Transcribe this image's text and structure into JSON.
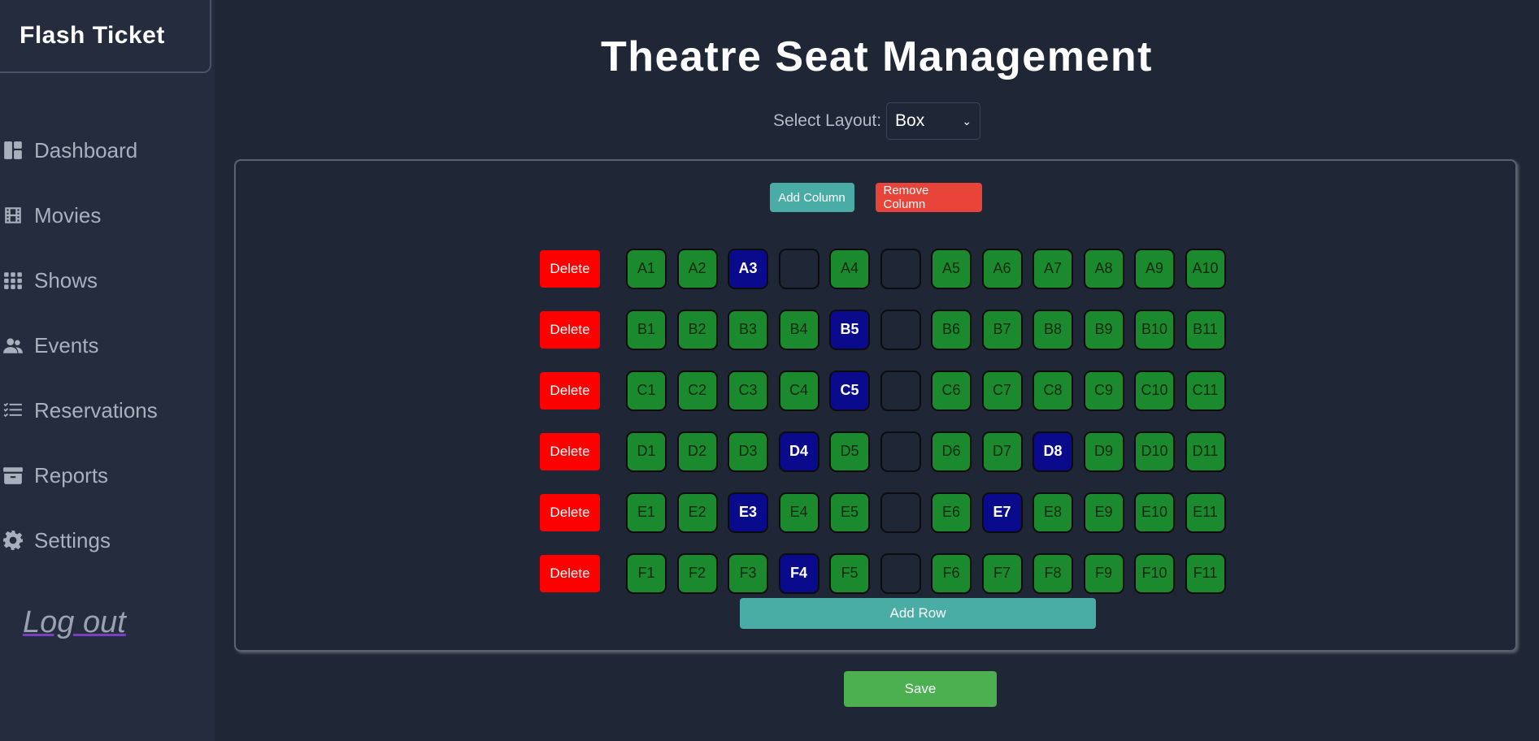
{
  "brand": "Flash Ticket",
  "sidebar": {
    "items": [
      {
        "label": "Dashboard",
        "icon": "dashboard-icon"
      },
      {
        "label": "Movies",
        "icon": "film-icon"
      },
      {
        "label": "Shows",
        "icon": "grid-icon"
      },
      {
        "label": "Events",
        "icon": "people-icon"
      },
      {
        "label": "Reservations",
        "icon": "list-icon"
      },
      {
        "label": "Reports",
        "icon": "archive-icon"
      },
      {
        "label": "Settings",
        "icon": "gear-icon"
      }
    ],
    "logout": "Log out"
  },
  "main": {
    "title": "Theatre Seat Management",
    "layout_label": "Select Layout:",
    "layout_value": "Box",
    "add_column": "Add Column",
    "remove_column": "Remove Column",
    "delete_label": "Delete",
    "add_row": "Add Row",
    "save": "Save"
  },
  "colors": {
    "available": "#1b8a2e",
    "booked": "#0a0a8c",
    "delete": "#ff0000",
    "teal": "#4aada5",
    "save": "#4caf50"
  },
  "seat_rows": [
    [
      {
        "l": "A1",
        "s": "available"
      },
      {
        "l": "A2",
        "s": "available"
      },
      {
        "l": "A3",
        "s": "booked"
      },
      {
        "l": "",
        "s": "gap"
      },
      {
        "l": "A4",
        "s": "available"
      },
      {
        "l": "",
        "s": "gap"
      },
      {
        "l": "A5",
        "s": "available"
      },
      {
        "l": "A6",
        "s": "available"
      },
      {
        "l": "A7",
        "s": "available"
      },
      {
        "l": "A8",
        "s": "available"
      },
      {
        "l": "A9",
        "s": "available"
      },
      {
        "l": "A10",
        "s": "available"
      }
    ],
    [
      {
        "l": "B1",
        "s": "available"
      },
      {
        "l": "B2",
        "s": "available"
      },
      {
        "l": "B3",
        "s": "available"
      },
      {
        "l": "B4",
        "s": "available"
      },
      {
        "l": "B5",
        "s": "booked"
      },
      {
        "l": "",
        "s": "gap"
      },
      {
        "l": "B6",
        "s": "available"
      },
      {
        "l": "B7",
        "s": "available"
      },
      {
        "l": "B8",
        "s": "available"
      },
      {
        "l": "B9",
        "s": "available"
      },
      {
        "l": "B10",
        "s": "available"
      },
      {
        "l": "B11",
        "s": "available"
      }
    ],
    [
      {
        "l": "C1",
        "s": "available"
      },
      {
        "l": "C2",
        "s": "available"
      },
      {
        "l": "C3",
        "s": "available"
      },
      {
        "l": "C4",
        "s": "available"
      },
      {
        "l": "C5",
        "s": "booked"
      },
      {
        "l": "",
        "s": "gap"
      },
      {
        "l": "C6",
        "s": "available"
      },
      {
        "l": "C7",
        "s": "available"
      },
      {
        "l": "C8",
        "s": "available"
      },
      {
        "l": "C9",
        "s": "available"
      },
      {
        "l": "C10",
        "s": "available"
      },
      {
        "l": "C11",
        "s": "available"
      }
    ],
    [
      {
        "l": "D1",
        "s": "available"
      },
      {
        "l": "D2",
        "s": "available"
      },
      {
        "l": "D3",
        "s": "available"
      },
      {
        "l": "D4",
        "s": "booked"
      },
      {
        "l": "D5",
        "s": "available"
      },
      {
        "l": "",
        "s": "gap"
      },
      {
        "l": "D6",
        "s": "available"
      },
      {
        "l": "D7",
        "s": "available"
      },
      {
        "l": "D8",
        "s": "booked"
      },
      {
        "l": "D9",
        "s": "available"
      },
      {
        "l": "D10",
        "s": "available"
      },
      {
        "l": "D11",
        "s": "available"
      }
    ],
    [
      {
        "l": "E1",
        "s": "available"
      },
      {
        "l": "E2",
        "s": "available"
      },
      {
        "l": "E3",
        "s": "booked"
      },
      {
        "l": "E4",
        "s": "available"
      },
      {
        "l": "E5",
        "s": "available"
      },
      {
        "l": "",
        "s": "gap"
      },
      {
        "l": "E6",
        "s": "available"
      },
      {
        "l": "E7",
        "s": "booked"
      },
      {
        "l": "E8",
        "s": "available"
      },
      {
        "l": "E9",
        "s": "available"
      },
      {
        "l": "E10",
        "s": "available"
      },
      {
        "l": "E11",
        "s": "available"
      }
    ],
    [
      {
        "l": "F1",
        "s": "available"
      },
      {
        "l": "F2",
        "s": "available"
      },
      {
        "l": "F3",
        "s": "available"
      },
      {
        "l": "F4",
        "s": "booked"
      },
      {
        "l": "F5",
        "s": "available"
      },
      {
        "l": "",
        "s": "gap"
      },
      {
        "l": "F6",
        "s": "available"
      },
      {
        "l": "F7",
        "s": "available"
      },
      {
        "l": "F8",
        "s": "available"
      },
      {
        "l": "F9",
        "s": "available"
      },
      {
        "l": "F10",
        "s": "available"
      },
      {
        "l": "F11",
        "s": "available"
      }
    ]
  ]
}
